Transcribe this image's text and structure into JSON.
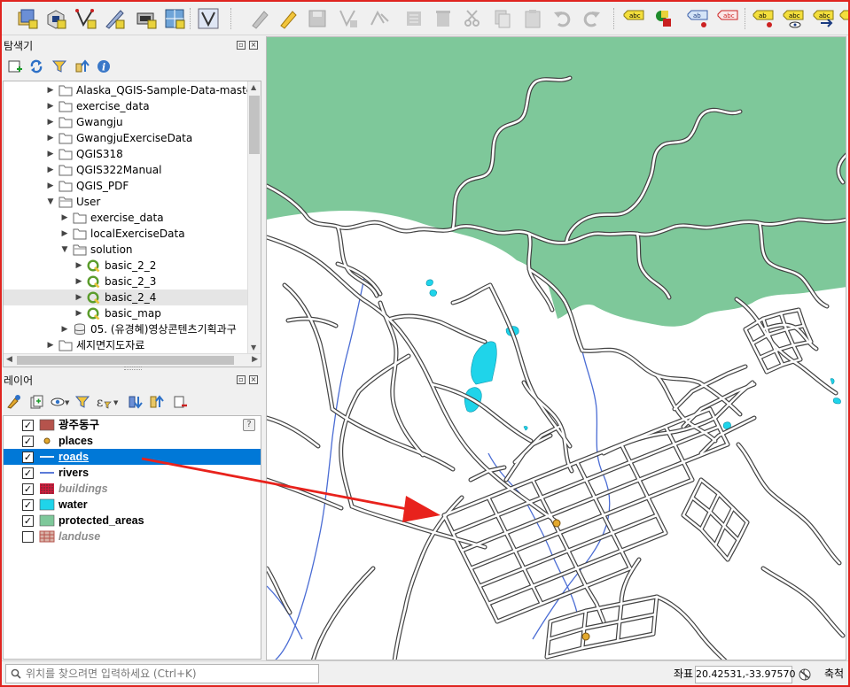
{
  "colors": {
    "selection": "#0078d7",
    "protected_area_fill": "#7ec89a",
    "water_fill": "#1fd4ea",
    "river_line": "#4a6cd4",
    "road_casing": "#424242",
    "road_fill": "#ffffff",
    "annotation_arrow": "#e8221c",
    "place_marker": "#e3a92e"
  },
  "toolbar": {
    "icons": [
      "open-data-source-manager-icon",
      "new-geopackage-layer-icon",
      "digitize-vector-icon",
      "add-feature-pen-icon",
      "new-virtual-layer-icon",
      "add-grid-icon",
      "vertex-tool-icon",
      "toggle-edit-icon",
      "digitize-pencil-icon",
      "save-edits-icon",
      "add-point-feature-icon",
      "vertex-editor-icon",
      "delete-selected-icon",
      "cut-features-icon",
      "copy-features-icon",
      "paste-features-icon",
      "undo-icon",
      "redo-icon",
      "label-abc-icon",
      "layer-labeling-icon",
      "pin-labels-icon",
      "show-hide-labels-icon",
      "preview-labels-icon",
      "highlight-pinned-labels-icon",
      "toggle-label-display-icon",
      "add-label-icon"
    ]
  },
  "browser_panel": {
    "title": "탐색기",
    "items": [
      {
        "label": "Alaska_QGIS-Sample-Data-master",
        "type": "folder",
        "depth": 0,
        "expanded": false
      },
      {
        "label": "exercise_data",
        "type": "folder",
        "depth": 0,
        "expanded": false
      },
      {
        "label": "Gwangju",
        "type": "folder",
        "depth": 0,
        "expanded": false
      },
      {
        "label": "GwangjuExerciseData",
        "type": "folder",
        "depth": 0,
        "expanded": false
      },
      {
        "label": "QGIS318",
        "type": "folder",
        "depth": 0,
        "expanded": false
      },
      {
        "label": "QGIS322Manual",
        "type": "folder",
        "depth": 0,
        "expanded": false
      },
      {
        "label": "QGIS_PDF",
        "type": "folder",
        "depth": 0,
        "expanded": false
      },
      {
        "label": "User",
        "type": "folder-open",
        "depth": 0,
        "expanded": true
      },
      {
        "label": "exercise_data",
        "type": "folder",
        "depth": 1,
        "expanded": false
      },
      {
        "label": "localExerciseData",
        "type": "folder",
        "depth": 1,
        "expanded": false
      },
      {
        "label": "solution",
        "type": "folder-open",
        "depth": 1,
        "expanded": true
      },
      {
        "label": "basic_2_2",
        "type": "qgis-project",
        "depth": 2,
        "expanded": false
      },
      {
        "label": "basic_2_3",
        "type": "qgis-project",
        "depth": 2,
        "expanded": false
      },
      {
        "label": "basic_2_4",
        "type": "qgis-project",
        "depth": 2,
        "expanded": false,
        "selected": true
      },
      {
        "label": "basic_map",
        "type": "qgis-project",
        "depth": 2,
        "expanded": false
      },
      {
        "label": "05. (유경혜)영상콘텐츠기획과구",
        "type": "database",
        "depth": 1,
        "expanded": false
      },
      {
        "label": "세지면지도자료",
        "type": "folder",
        "depth": 0,
        "expanded": false
      }
    ]
  },
  "layers_panel": {
    "title": "레이어",
    "help_badge": "?",
    "layers": [
      {
        "name": "광주동구",
        "checked": true,
        "symbol": "polygon-solid",
        "color": "#b5534c",
        "style": "normal"
      },
      {
        "name": "places",
        "checked": true,
        "symbol": "point",
        "color": "#e3a92e",
        "style": "normal"
      },
      {
        "name": "roads",
        "checked": true,
        "symbol": "line",
        "color": "#1a1a1a",
        "style": "selected"
      },
      {
        "name": "rivers",
        "checked": true,
        "symbol": "line",
        "color": "#4a6cd4",
        "style": "normal"
      },
      {
        "name": "buildings",
        "checked": true,
        "symbol": "polygon-dots",
        "color": "#d11c3c",
        "style": "dim"
      },
      {
        "name": "water",
        "checked": true,
        "symbol": "polygon-solid",
        "color": "#1fd4ea",
        "style": "normal"
      },
      {
        "name": "protected_areas",
        "checked": true,
        "symbol": "polygon-solid",
        "color": "#7ec89a",
        "style": "normal"
      },
      {
        "name": "landuse",
        "checked": false,
        "symbol": "polygon-grid",
        "color": "#b5534c",
        "style": "dim"
      }
    ]
  },
  "statusbar": {
    "locator_placeholder": "위치를 찾으려면 입력하세요 (Ctrl+K)",
    "coordinate_label": "좌표",
    "coordinate_value": "20.42531,-33.97570",
    "scale_label": "축척"
  }
}
